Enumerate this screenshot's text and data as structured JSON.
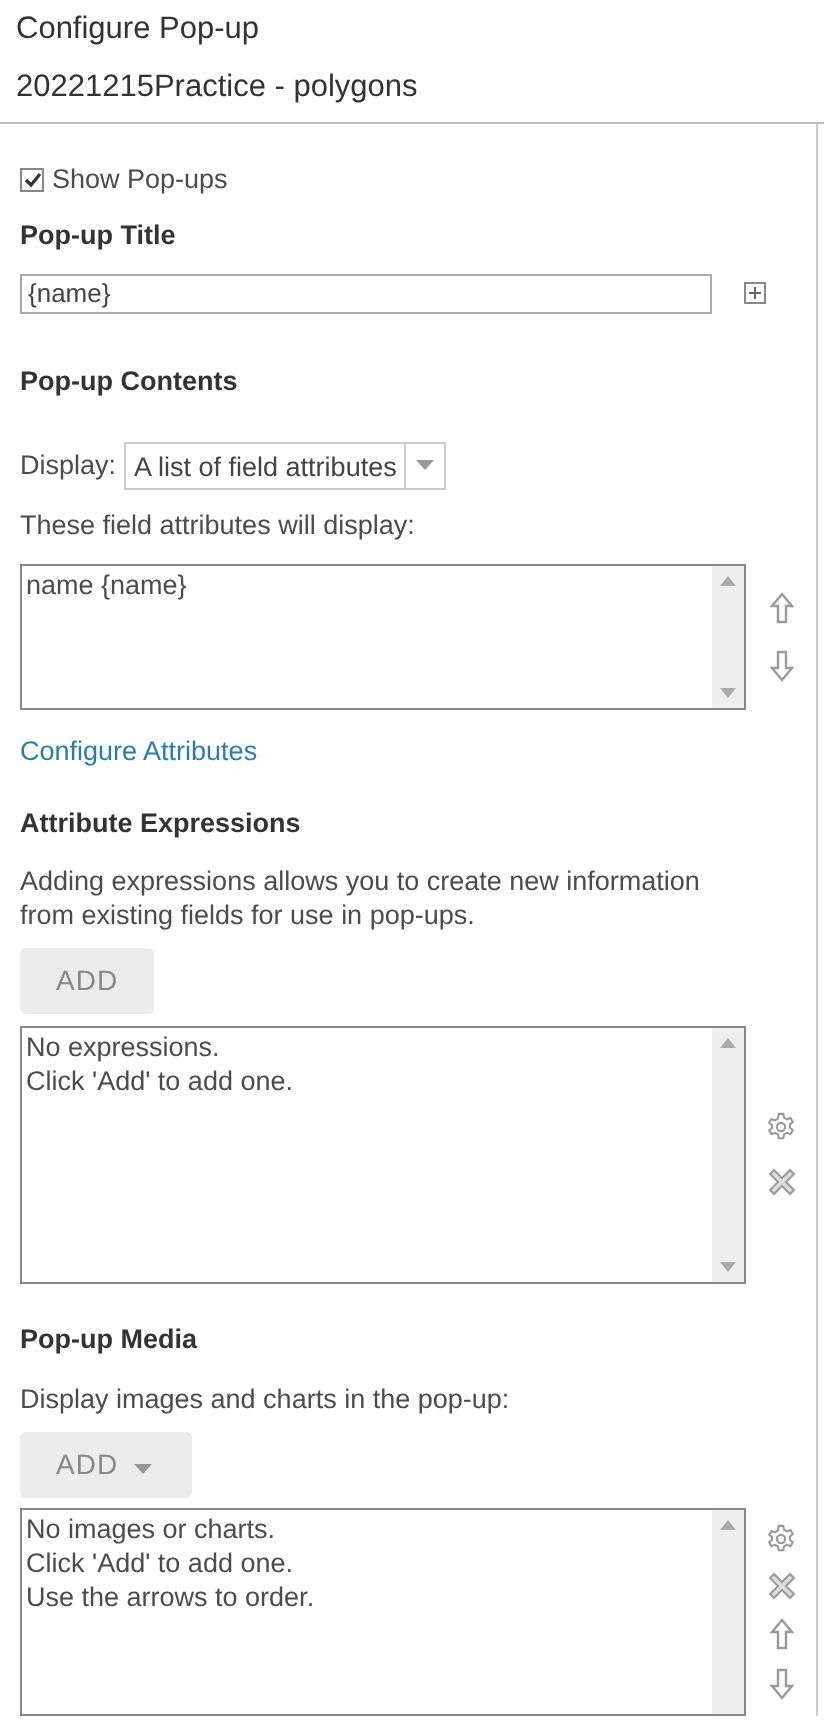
{
  "panel_title": "Configure Pop-up",
  "layer_name": "20221215Practice - polygons",
  "show_popups": {
    "label": "Show Pop-ups",
    "checked": true
  },
  "title_section": {
    "heading": "Pop-up Title",
    "value": "{name}"
  },
  "contents_section": {
    "heading": "Pop-up Contents",
    "display_label": "Display:",
    "display_value": "A list of field attributes",
    "list_caption": "These field attributes will display:",
    "list_lines": [
      "name {name}"
    ],
    "side_tools": [
      {
        "kind": "up"
      },
      {
        "kind": "down"
      }
    ],
    "link": "Configure Attributes"
  },
  "expressions_section": {
    "heading": "Attribute Expressions",
    "description": "Adding expressions allows you to create new information from existing fields for use in pop-ups.",
    "add_button": {
      "label": "ADD",
      "has_menu": false
    },
    "list_lines": [
      "No expressions.",
      "Click 'Add' to add one."
    ],
    "side_tools": [
      {
        "kind": "settings"
      },
      {
        "kind": "delete"
      }
    ]
  },
  "media_section": {
    "heading": "Pop-up Media",
    "description": "Display images and charts in the pop-up:",
    "add_button": {
      "label": "ADD",
      "has_menu": true
    },
    "list_lines": [
      "No images or charts.",
      "Click 'Add' to add one.",
      "Use the arrows to order."
    ],
    "side_tools": [
      {
        "kind": "settings"
      },
      {
        "kind": "delete"
      },
      {
        "kind": "up"
      },
      {
        "kind": "down"
      }
    ]
  }
}
